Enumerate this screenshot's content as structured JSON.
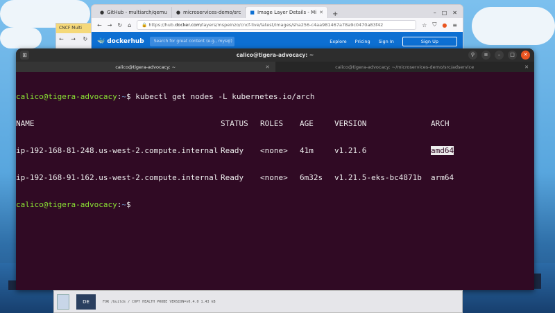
{
  "browser": {
    "tabs": [
      {
        "label": "GitHub - multiarch/qemu"
      },
      {
        "label": "microservices-demo/src"
      },
      {
        "label": "Image Layer Details - Mi"
      }
    ],
    "new_tab": "+",
    "url_host": "https://hub.",
    "url_domain": "docker.com",
    "url_path": "/layers/mspeinzo/cncf-live/latest/images/sha256-c4aa981467a78a9c0470a83f42",
    "dockerhub": {
      "logo": "dockerhub",
      "search_placeholder": "Search for great content (e.g., mysql)",
      "explore": "Explore",
      "pricing": "Pricing",
      "signin": "Sign In",
      "signup": "Sign Up"
    }
  },
  "browser2": {
    "tab": "CNCF Multi"
  },
  "terminal": {
    "title": "calico@tigera-advocacy: ~",
    "tabs": [
      {
        "label": "calico@tigera-advocacy: ~"
      },
      {
        "label": "calico@tigera-advocacy: ~/microservices-demo/src/adservice"
      }
    ],
    "prompt": {
      "user": "calico@tigera-advocacy",
      "sep": ":",
      "path": "~",
      "sym": "$ "
    },
    "command": "kubectl get nodes -L kubernetes.io/arch",
    "headers": [
      "NAME",
      "STATUS",
      "ROLES",
      "AGE",
      "VERSION",
      "ARCH"
    ],
    "rows": [
      [
        "ip-192-168-81-248.us-west-2.compute.internal",
        "Ready",
        "<none>",
        "41m",
        "v1.21.6",
        "amd64"
      ],
      [
        "ip-192-168-91-162.us-west-2.compute.internal",
        "Ready",
        "<none>",
        "6m32s",
        "v1.21.5-eks-bc4871b",
        "arm64"
      ]
    ]
  },
  "bottom_window": {
    "badge": "DE",
    "text": "FOR /builds   / COPY HEALTH PROBE VERSION=v0.4.0       1.43 kB"
  }
}
